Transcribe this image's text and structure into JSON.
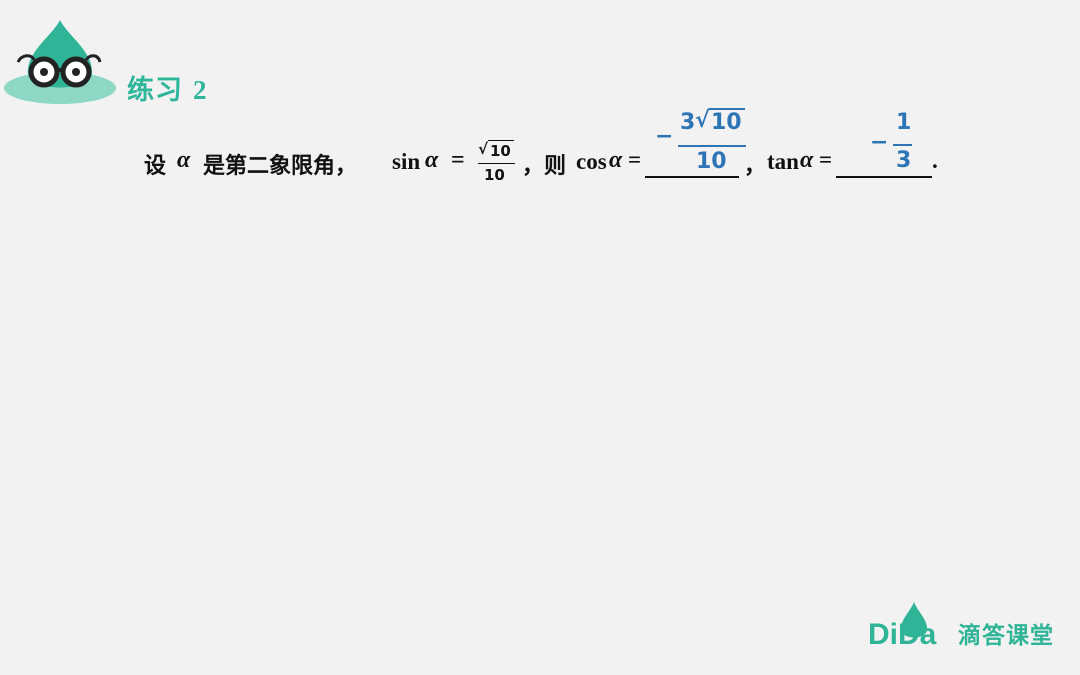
{
  "heading": {
    "label": "练习",
    "number": "2"
  },
  "problem": {
    "p1": "设",
    "alpha": "α",
    "p2": "是第二象限角，",
    "sin_label": "sin",
    "eq": "=",
    "sin_num": "10",
    "sin_den": "10",
    "p3": "，则",
    "cos_label": "cos",
    "eq2": "=",
    "p4": "，",
    "tan_label": "tan",
    "period": "."
  },
  "answers": {
    "cos": {
      "sign": "−",
      "coef": "3",
      "radicand": "10",
      "den": "10"
    },
    "tan": {
      "sign": "−",
      "num": "1",
      "den": "3"
    }
  },
  "footer": {
    "logo_text": "DiDa",
    "brand": "滴答课堂"
  },
  "colors": {
    "accent": "#2fb59a",
    "answer": "#2e75b6",
    "background": "#f2f2f2"
  }
}
